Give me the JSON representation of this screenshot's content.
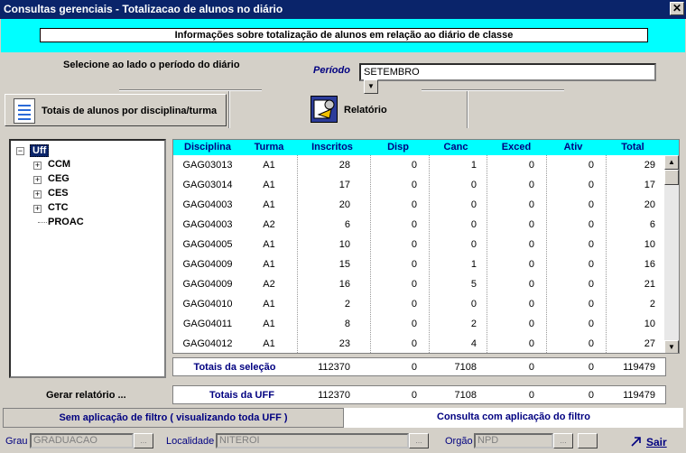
{
  "window": {
    "title": "Consultas gerenciais - Totalizacao de alunos no diário",
    "close": "✕"
  },
  "header": {
    "info": "Informações sobre totalização de alunos em relação ao diário de classe"
  },
  "selector": {
    "hint": "Selecione ao lado o período do diário",
    "periodo_label": "Período",
    "periodo_value": "SETEMBRO"
  },
  "tabs": {
    "totais": "Totais de alunos por disciplina/turma",
    "relatorio": "Relatório"
  },
  "tree": {
    "root": "Uff",
    "children": [
      "CCM",
      "CEG",
      "CES",
      "CTC",
      "PROAC"
    ]
  },
  "grid": {
    "columns": [
      "Disciplina",
      "Turma",
      "Inscritos",
      "Disp",
      "Canc",
      "Exced",
      "Ativ",
      "Total"
    ],
    "rows": [
      [
        "GAG03013",
        "A1",
        "28",
        "0",
        "1",
        "0",
        "0",
        "29"
      ],
      [
        "GAG03014",
        "A1",
        "17",
        "0",
        "0",
        "0",
        "0",
        "17"
      ],
      [
        "GAG04003",
        "A1",
        "20",
        "0",
        "0",
        "0",
        "0",
        "20"
      ],
      [
        "GAG04003",
        "A2",
        "6",
        "0",
        "0",
        "0",
        "0",
        "6"
      ],
      [
        "GAG04005",
        "A1",
        "10",
        "0",
        "0",
        "0",
        "0",
        "10"
      ],
      [
        "GAG04009",
        "A1",
        "15",
        "0",
        "1",
        "0",
        "0",
        "16"
      ],
      [
        "GAG04009",
        "A2",
        "16",
        "0",
        "5",
        "0",
        "0",
        "21"
      ],
      [
        "GAG04010",
        "A1",
        "2",
        "0",
        "0",
        "0",
        "0",
        "2"
      ],
      [
        "GAG04011",
        "A1",
        "8",
        "0",
        "2",
        "0",
        "0",
        "10"
      ],
      [
        "GAG04012",
        "A1",
        "23",
        "0",
        "4",
        "0",
        "0",
        "27"
      ]
    ]
  },
  "totals": {
    "selecao": {
      "label": "Totais da seleção",
      "inscritos": "112370",
      "disp": "0",
      "canc": "7108",
      "exced": "0",
      "ativ": "0",
      "total": "119479"
    },
    "uff": {
      "label": "Totais da UFF",
      "inscritos": "112370",
      "disp": "0",
      "canc": "7108",
      "exced": "0",
      "ativ": "0",
      "total": "119479"
    }
  },
  "actions": {
    "gerar": "Gerar relatório ...",
    "sair": "Sair"
  },
  "filter_tabs": {
    "sem": "Sem aplicação de filtro ( visualizando toda UFF )",
    "com": "Consulta com aplicação do filtro"
  },
  "status": {
    "grau_label": "Grau",
    "grau_value": "GRADUACAO",
    "localidade_label": "Localidade",
    "localidade_value": "NITEROI",
    "orgao_label": "Orgão",
    "orgao_value": "NPD",
    "ellipsis": "..."
  }
}
